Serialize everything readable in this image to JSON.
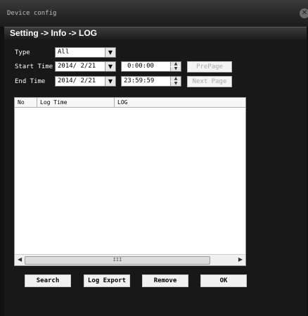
{
  "window": {
    "title": "Device config"
  },
  "breadcrumb": "Setting -> Info -> LOG",
  "filters": {
    "type_label": "Type",
    "type_value": "All",
    "start_label": "Start Time",
    "start_date": "2014/ 2/21",
    "start_time": "0:00:00",
    "end_label": "End Time",
    "end_date": "2014/ 2/21",
    "end_time": "23:59:59"
  },
  "paging": {
    "prev_label": "PrePage",
    "next_label": "Next Page"
  },
  "log_table": {
    "columns": [
      "No",
      "Log Time",
      "LOG"
    ],
    "rows": [],
    "scroll_thumb_label": "III"
  },
  "actions": {
    "search": "Search",
    "log_export": "Log Export",
    "remove": "Remove",
    "ok": "OK"
  }
}
